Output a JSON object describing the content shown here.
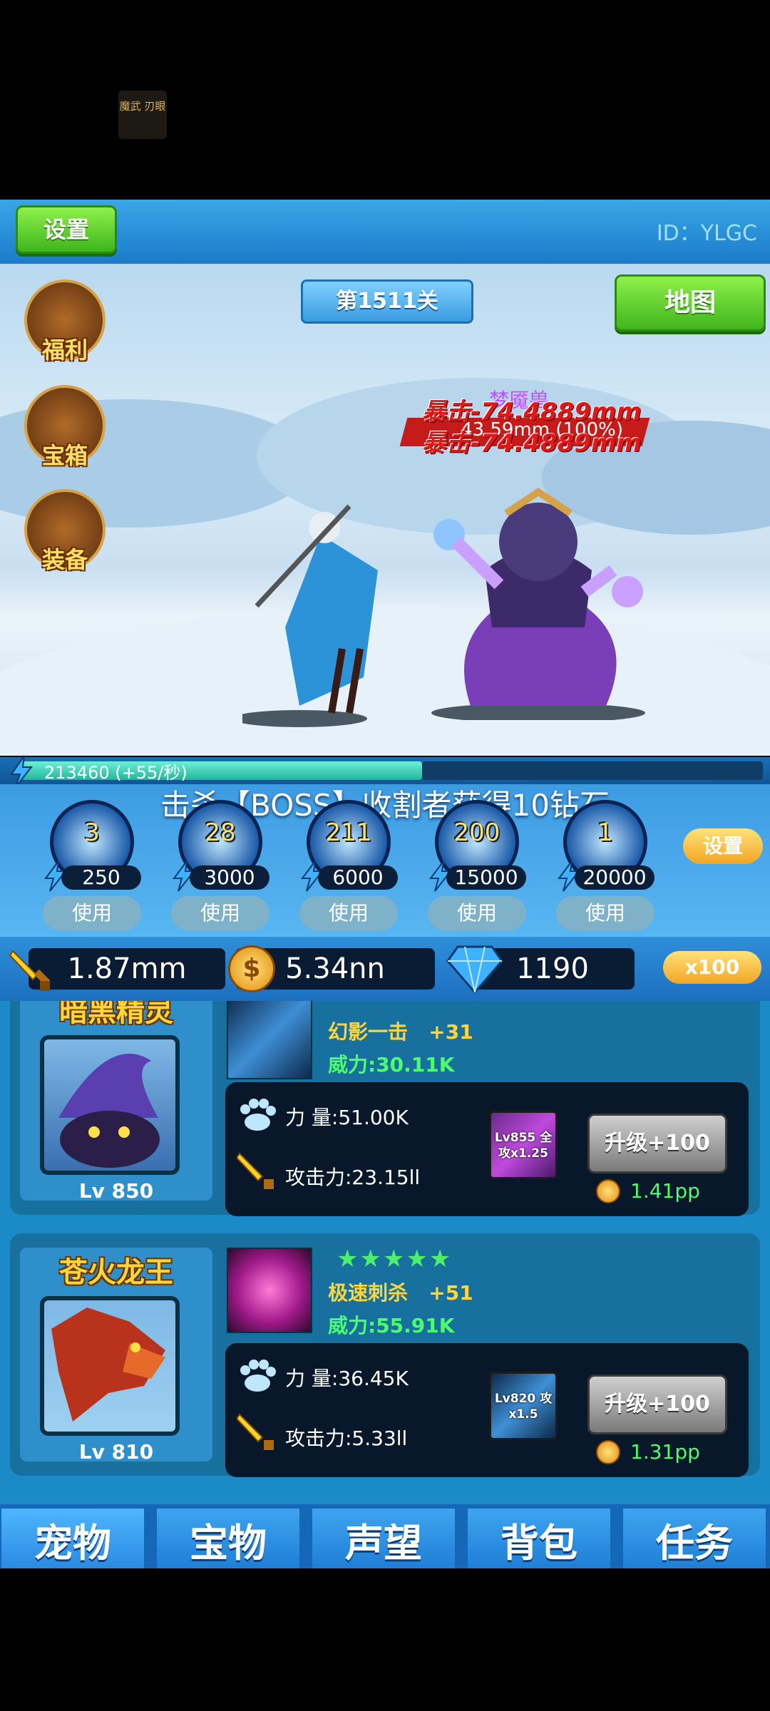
{
  "logo": {
    "text": "魔武 刃眼"
  },
  "header": {
    "settings_label": "设置",
    "player_id": "ID：YLGC"
  },
  "scene": {
    "stage": "第1511关",
    "map_label": "地图",
    "side_buttons": [
      {
        "label": "福利",
        "icon": "gift-basket-icon"
      },
      {
        "label": "宝箱",
        "icon": "treasure-chest-icon"
      },
      {
        "label": "装备",
        "icon": "helmet-icon"
      }
    ],
    "damage_texts": [
      "暴击-74.4889mm",
      "暴击-74.4889mm"
    ],
    "boss_name": "梦魇兽",
    "boss_hp": "43.59mm (100%)"
  },
  "energy": {
    "text": "213460  (+55/秒)",
    "fill": 0.54
  },
  "notice": "击杀【BOSS】收割者获得10钻石",
  "skills": {
    "settings_label": "设置",
    "items": [
      {
        "count": "3",
        "cost": "250",
        "use": "使用"
      },
      {
        "count": "28",
        "cost": "3000",
        "use": "使用"
      },
      {
        "count": "211",
        "cost": "6000",
        "use": "使用"
      },
      {
        "count": "200",
        "cost": "15000",
        "use": "使用"
      },
      {
        "count": "1",
        "cost": "20000",
        "use": "使用"
      }
    ]
  },
  "resources": {
    "attack": "1.87mm",
    "gold": "5.34nn",
    "diamonds": "1190",
    "multiplier": "x100"
  },
  "pets": [
    {
      "name": "暗黑精灵",
      "level": "Lv 850",
      "skill_name": "幻影一击",
      "skill_bonus": "+31",
      "power": "威力:30.11K",
      "strength": "力  量:51.00K",
      "attack": "攻击力:23.15ll",
      "badge": "Lv855 全攻x1.25",
      "upgrade": "升级+100",
      "cost": "1.41pp",
      "stars": ""
    },
    {
      "name": "苍火龙王",
      "level": "Lv 810",
      "skill_name": "极速刺杀",
      "skill_bonus": "+51",
      "power": "威力:55.91K",
      "strength": "力  量:36.45K",
      "attack": "攻击力:5.33ll",
      "badge": "Lv820 攻x1.5",
      "upgrade": "升级+100",
      "cost": "1.31pp",
      "stars": "★★★★★"
    }
  ],
  "tabs": [
    "宠物",
    "宝物",
    "声望",
    "背包",
    "任务"
  ]
}
